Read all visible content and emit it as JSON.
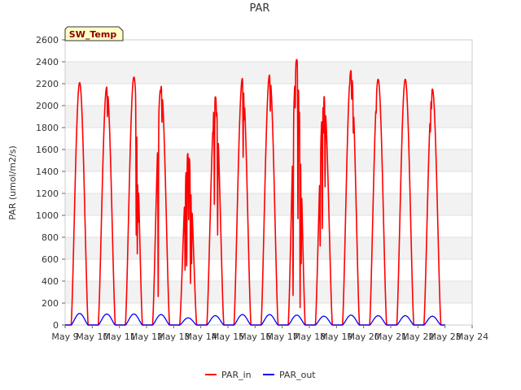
{
  "chart_data": {
    "type": "line",
    "title": "PAR",
    "xlabel": "",
    "ylabel": "PAR (umol/m2/s)",
    "xlim": [
      9,
      24
    ],
    "ylim": [
      0,
      2600
    ],
    "x_ticks": [
      9,
      10,
      11,
      12,
      13,
      14,
      15,
      16,
      17,
      18,
      19,
      20,
      21,
      22,
      23,
      24
    ],
    "x_tick_labels": [
      "May 9",
      "May 10",
      "May 11",
      "May 12",
      "May 13",
      "May 14",
      "May 15",
      "May 16",
      "May 17",
      "May 18",
      "May 19",
      "May 20",
      "May 21",
      "May 22",
      "May 23",
      "May 24"
    ],
    "y_ticks": [
      0,
      200,
      400,
      600,
      800,
      1000,
      1200,
      1400,
      1600,
      1800,
      2000,
      2200,
      2400,
      2600
    ],
    "y_tick_labels": [
      "0",
      "200",
      "400",
      "600",
      "800",
      "1000",
      "1200",
      "1400",
      "1600",
      "1800",
      "2000",
      "2200",
      "2400",
      "2600"
    ],
    "grid": true,
    "annotation": "SW_Temp",
    "legend_position": "bottom-center",
    "series": [
      {
        "name": "PAR_in",
        "color": "#ff0000",
        "days": [
          {
            "day": 9,
            "peak": 2210,
            "dips": []
          },
          {
            "day": 10,
            "peak": 2170,
            "dips": [
              [
                0.56,
                1900
              ],
              [
                0.62,
                1980
              ]
            ]
          },
          {
            "day": 11,
            "peak": 2260,
            "dips": [
              [
                0.62,
                820
              ],
              [
                0.66,
                650
              ],
              [
                0.69,
                940
              ]
            ]
          },
          {
            "day": 12,
            "peak": 2180,
            "dips": [
              [
                0.43,
                260
              ],
              [
                0.52,
                2120
              ],
              [
                0.57,
                1850
              ]
            ]
          },
          {
            "day": 13,
            "peak": 1570,
            "dips": [
              [
                0.42,
                500
              ],
              [
                0.48,
                540
              ],
              [
                0.55,
                960
              ],
              [
                0.62,
                380
              ],
              [
                0.66,
                560
              ]
            ]
          },
          {
            "day": 14,
            "peak": 2080,
            "dips": [
              [
                0.45,
                1750
              ],
              [
                0.5,
                1100
              ],
              [
                0.58,
                1900
              ],
              [
                0.62,
                820
              ]
            ]
          },
          {
            "day": 15,
            "peak": 2250,
            "dips": [
              [
                0.56,
                1530
              ],
              [
                0.6,
                1870
              ]
            ]
          },
          {
            "day": 16,
            "peak": 2280,
            "dips": [
              [
                0.56,
                1950
              ]
            ]
          },
          {
            "day": 17,
            "peak": 2420,
            "dips": [
              [
                0.4,
                270
              ],
              [
                0.48,
                1980
              ],
              [
                0.58,
                970
              ],
              [
                0.62,
                1760
              ],
              [
                0.66,
                160
              ],
              [
                0.7,
                560
              ]
            ]
          },
          {
            "day": 18,
            "peak": 2090,
            "dips": [
              [
                0.4,
                720
              ],
              [
                0.48,
                880
              ],
              [
                0.52,
                1750
              ],
              [
                0.58,
                1260
              ],
              [
                0.62,
                2000
              ]
            ]
          },
          {
            "day": 19,
            "peak": 2320,
            "dips": [
              [
                0.48,
                2180
              ],
              [
                0.56,
                2060
              ],
              [
                0.62,
                1750
              ]
            ]
          },
          {
            "day": 20,
            "peak": 2240,
            "dips": [
              [
                0.46,
                1930
              ]
            ]
          },
          {
            "day": 21,
            "peak": 2240,
            "dips": []
          },
          {
            "day": 22,
            "peak": 2150,
            "dips": [
              [
                0.46,
                1760
              ],
              [
                0.5,
                1970
              ]
            ]
          }
        ]
      },
      {
        "name": "PAR_out",
        "color": "#0000ff",
        "days": [
          {
            "day": 9,
            "peak": 105
          },
          {
            "day": 10,
            "peak": 100
          },
          {
            "day": 11,
            "peak": 100
          },
          {
            "day": 12,
            "peak": 95
          },
          {
            "day": 13,
            "peak": 65
          },
          {
            "day": 14,
            "peak": 85
          },
          {
            "day": 15,
            "peak": 95
          },
          {
            "day": 16,
            "peak": 95
          },
          {
            "day": 17,
            "peak": 90
          },
          {
            "day": 18,
            "peak": 80
          },
          {
            "day": 19,
            "peak": 90
          },
          {
            "day": 20,
            "peak": 85
          },
          {
            "day": 21,
            "peak": 85
          },
          {
            "day": 22,
            "peak": 80
          }
        ]
      }
    ]
  }
}
